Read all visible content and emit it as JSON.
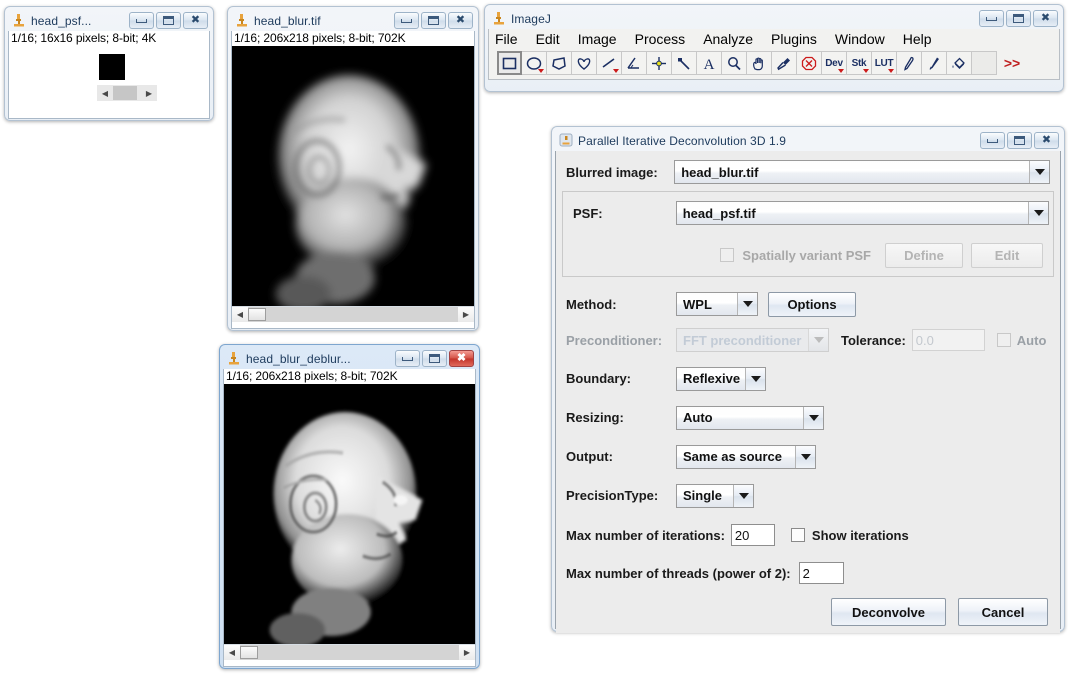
{
  "windows": {
    "psf": {
      "title": "head_psf...",
      "info": "1/16; 16x16 pixels; 8-bit; 4K",
      "icon_name": "imagej-microscope-icon",
      "buttons": {
        "minimize": "minimize",
        "maximize": "maximize",
        "close": "close"
      }
    },
    "blur": {
      "title": "head_blur.tif",
      "info": "1/16; 206x218 pixels; 8-bit; 702K",
      "icon_name": "imagej-microscope-icon",
      "buttons": {
        "minimize": "minimize",
        "maximize": "maximize",
        "close": "close"
      }
    },
    "deblur": {
      "title": "head_blur_deblur...",
      "info": "1/16; 206x218 pixels; 8-bit; 702K",
      "icon_name": "imagej-microscope-icon",
      "buttons": {
        "minimize": "minimize",
        "maximize": "maximize",
        "close": "close"
      }
    }
  },
  "imagej": {
    "title": "ImageJ",
    "menus": [
      "File",
      "Edit",
      "Image",
      "Process",
      "Analyze",
      "Plugins",
      "Window",
      "Help"
    ],
    "tools": [
      {
        "name": "rectangle-tool",
        "label": "",
        "selected": true,
        "dropdown": false
      },
      {
        "name": "oval-tool",
        "label": "",
        "selected": false,
        "dropdown": true
      },
      {
        "name": "polygon-tool",
        "label": "",
        "selected": false,
        "dropdown": false
      },
      {
        "name": "freehand-tool",
        "label": "",
        "selected": false,
        "dropdown": false
      },
      {
        "name": "line-tool",
        "label": "",
        "selected": false,
        "dropdown": true
      },
      {
        "name": "angle-tool",
        "label": "",
        "selected": false,
        "dropdown": false
      },
      {
        "name": "point-tool",
        "label": "",
        "selected": false,
        "dropdown": false
      },
      {
        "name": "wand-tool",
        "label": "",
        "selected": false,
        "dropdown": false
      },
      {
        "name": "text-tool",
        "label": "A",
        "selected": false,
        "dropdown": false
      },
      {
        "name": "magnifier-tool",
        "label": "",
        "selected": false,
        "dropdown": false
      },
      {
        "name": "hand-tool",
        "label": "",
        "selected": false,
        "dropdown": false
      },
      {
        "name": "dropper-tool",
        "label": "",
        "selected": false,
        "dropdown": false
      },
      {
        "name": "stop-tool",
        "label": "",
        "selected": false,
        "dropdown": false
      },
      {
        "name": "dev-tool",
        "label": "Dev",
        "selected": false,
        "dropdown": true
      },
      {
        "name": "stk-tool",
        "label": "Stk",
        "selected": false,
        "dropdown": true
      },
      {
        "name": "lut-tool",
        "label": "LUT",
        "selected": false,
        "dropdown": true
      },
      {
        "name": "pencil-tool",
        "label": "",
        "selected": false,
        "dropdown": false
      },
      {
        "name": "brush-tool",
        "label": "",
        "selected": false,
        "dropdown": false
      },
      {
        "name": "flood-fill-tool",
        "label": "",
        "selected": false,
        "dropdown": false
      },
      {
        "name": "empty-tool",
        "label": "",
        "selected": false,
        "dropdown": false
      }
    ],
    "more_tools_label": ">>"
  },
  "dialog": {
    "title": "Parallel Iterative Deconvolution 3D 1.9",
    "fields": {
      "blurred_image_label": "Blurred image:",
      "blurred_image_value": "head_blur.tif",
      "psf_label": "PSF:",
      "psf_value": "head_psf.tif",
      "spatially_variant_label": "Spatially variant PSF",
      "define_label": "Define",
      "edit_label": "Edit",
      "method_label": "Method:",
      "method_value": "WPL",
      "options_label": "Options",
      "preconditioner_label": "Preconditioner:",
      "preconditioner_value": "FFT preconditioner",
      "tolerance_label": "Tolerance:",
      "tolerance_value": "0.0",
      "auto_label": "Auto",
      "boundary_label": "Boundary:",
      "boundary_value": "Reflexive",
      "resizing_label": "Resizing:",
      "resizing_value": "Auto",
      "output_label": "Output:",
      "output_value": "Same as source",
      "precision_label": "PrecisionType:",
      "precision_value": "Single",
      "max_iterations_label": "Max number of iterations:",
      "max_iterations_value": "20",
      "show_iterations_label": "Show iterations",
      "max_threads_label": "Max number of threads (power of 2):",
      "max_threads_value": "2"
    },
    "actions": {
      "deconvolve_label": "Deconvolve",
      "cancel_label": "Cancel"
    }
  },
  "colors": {
    "accent": "#2b4b6e",
    "close_red": "#c3342a",
    "tool_blue": "#1b2f63",
    "tool_red": "#cc1b1b",
    "dialog_bg": "#ececec"
  }
}
